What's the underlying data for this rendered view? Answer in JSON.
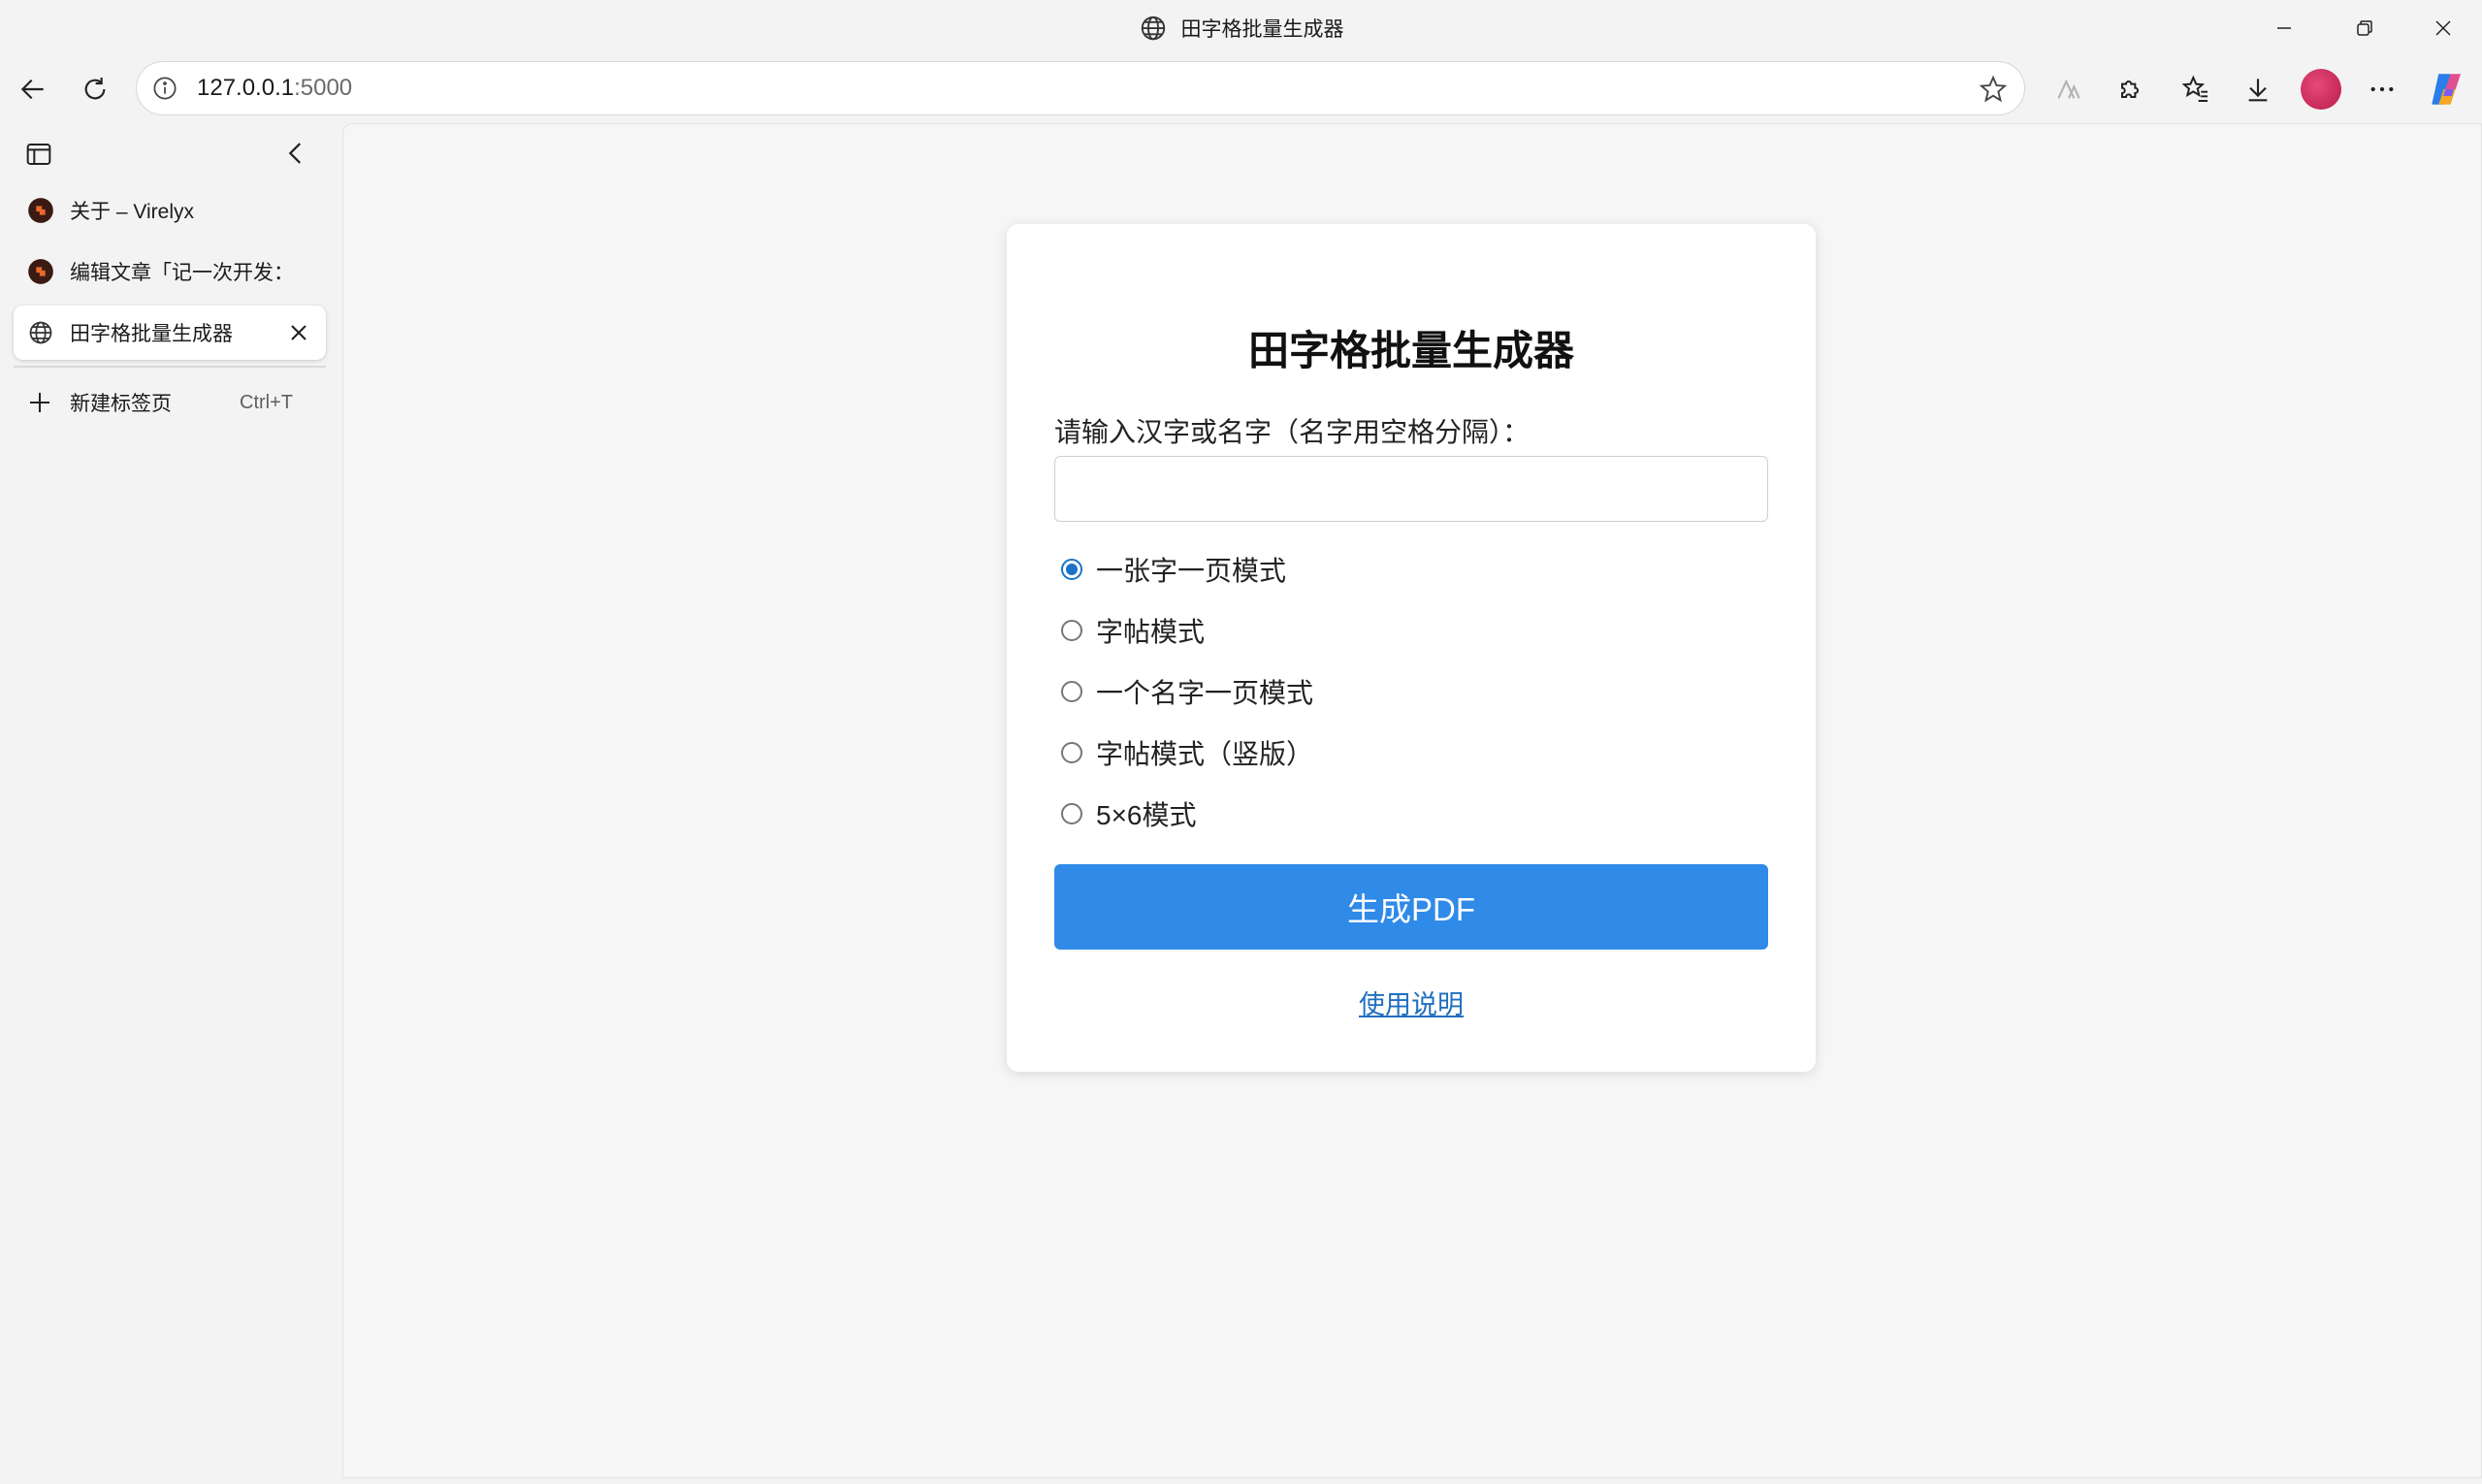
{
  "window": {
    "title": "田字格批量生成器"
  },
  "toolbar": {
    "url_host": "127.0.0.1",
    "url_port": ":5000"
  },
  "sidebar": {
    "tabs": [
      {
        "label": "关于 – Virelyx",
        "active": false
      },
      {
        "label": "编辑文章「记一次开发：",
        "active": false
      },
      {
        "label": "田字格批量生成器",
        "active": true
      }
    ],
    "new_tab_label": "新建标签页",
    "new_tab_shortcut": "Ctrl+T"
  },
  "page": {
    "heading": "田字格批量生成器",
    "prompt": "请输入汉字或名字（名字用空格分隔）：",
    "input_value": "",
    "modes": [
      {
        "label": "一张字一页模式",
        "checked": true
      },
      {
        "label": "字帖模式",
        "checked": false
      },
      {
        "label": "一个名字一页模式",
        "checked": false
      },
      {
        "label": "字帖模式（竖版）",
        "checked": false
      },
      {
        "label": "5×6模式",
        "checked": false
      }
    ],
    "generate_button": "生成PDF",
    "help_link": "使用说明"
  },
  "colors": {
    "accent": "#2f8ae8",
    "link": "#1f6fbf",
    "radio_checked": "#1a73c7"
  }
}
